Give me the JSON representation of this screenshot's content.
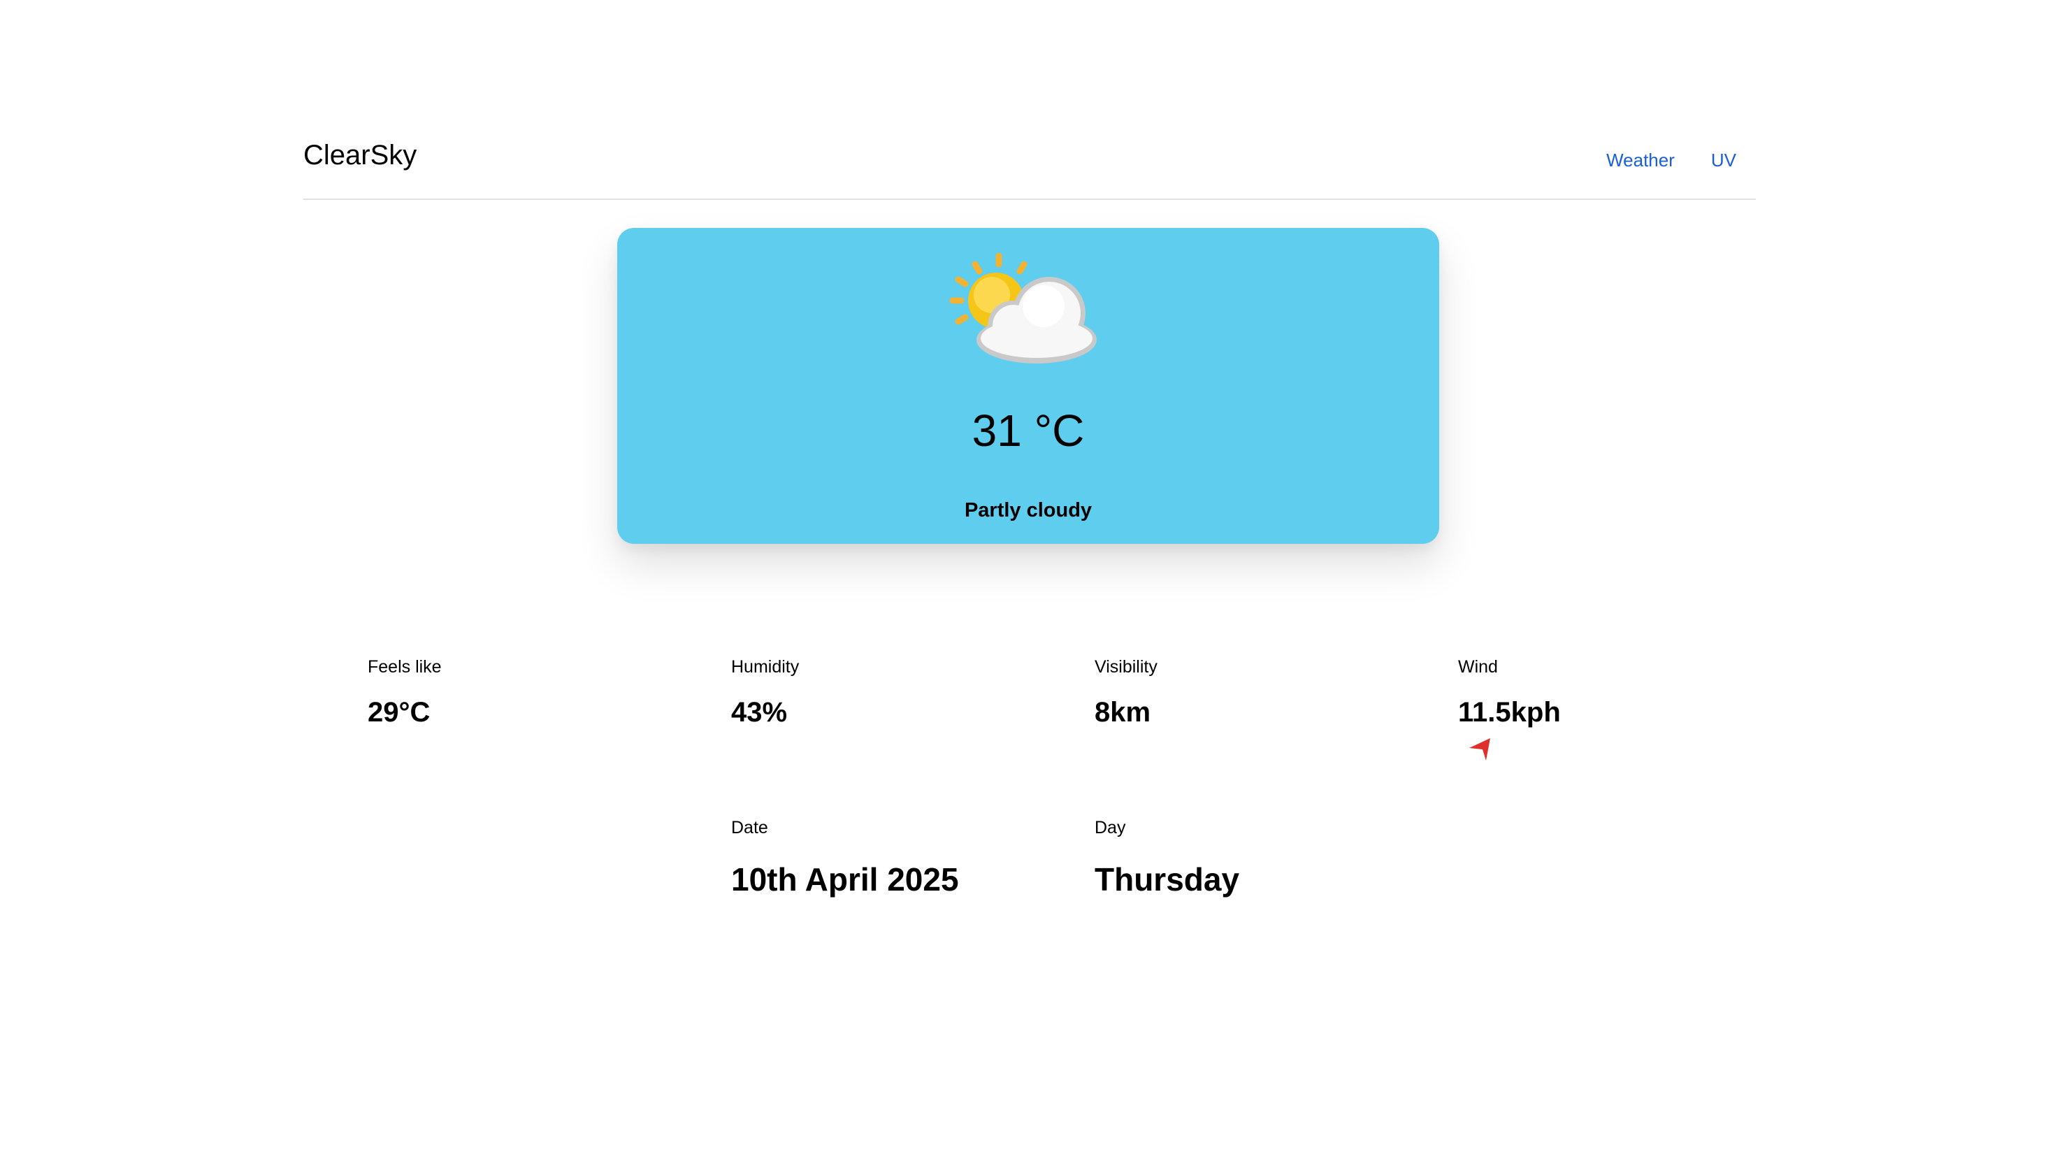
{
  "header": {
    "brand": "ClearSky",
    "nav": [
      "Weather",
      "UV"
    ]
  },
  "current": {
    "icon": "partly-cloudy-icon",
    "temperature": "31 °C",
    "condition": "Partly cloudy"
  },
  "stats": [
    {
      "label": "Feels like",
      "value": "29°C"
    },
    {
      "label": "Humidity",
      "value": "43%"
    },
    {
      "label": "Visibility",
      "value": "8km"
    },
    {
      "label": "Wind",
      "value": "11.5kph"
    }
  ],
  "wind_direction_icon": "navigation-arrow-icon",
  "date_info": [
    {
      "label": "Date",
      "value": "10th April 2025"
    },
    {
      "label": "Day",
      "value": "Thursday"
    }
  ],
  "colors": {
    "card": "#5fcdee",
    "link": "#1a5fd6",
    "wind_arrow": "#e0302a"
  }
}
